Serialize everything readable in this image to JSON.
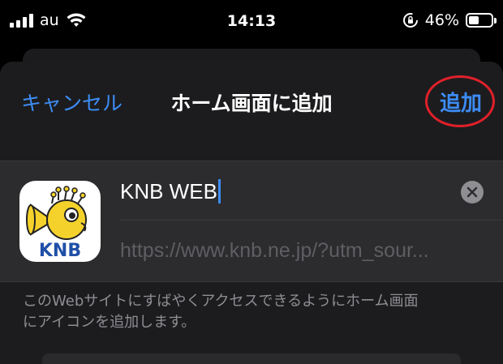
{
  "status_bar": {
    "carrier": "au",
    "time": "14:13",
    "battery_percent": "46%",
    "icons": [
      "signal-icon",
      "wifi-icon",
      "rotation-lock-icon",
      "battery-icon"
    ]
  },
  "nav": {
    "cancel_label": "キャンセル",
    "title": "ホーム画面に追加",
    "add_label": "追加"
  },
  "form": {
    "app_name": "KNB WEB",
    "url_placeholder": "https://www.knb.ne.jp/?utm_sour...",
    "icon_text": "KNB"
  },
  "helper_text_line1": "このWebサイトにすばやくアクセスできるようにホーム画面",
  "helper_text_line2": "にアイコンを追加します。",
  "colors": {
    "accent": "#3d8cf5",
    "sheet_bg": "#1c1c1e",
    "group_bg": "#2c2c2e",
    "annotation_circle": "#e0202a",
    "logo_blue": "#1f4fa8",
    "logo_yellow": "#f5d22b"
  }
}
